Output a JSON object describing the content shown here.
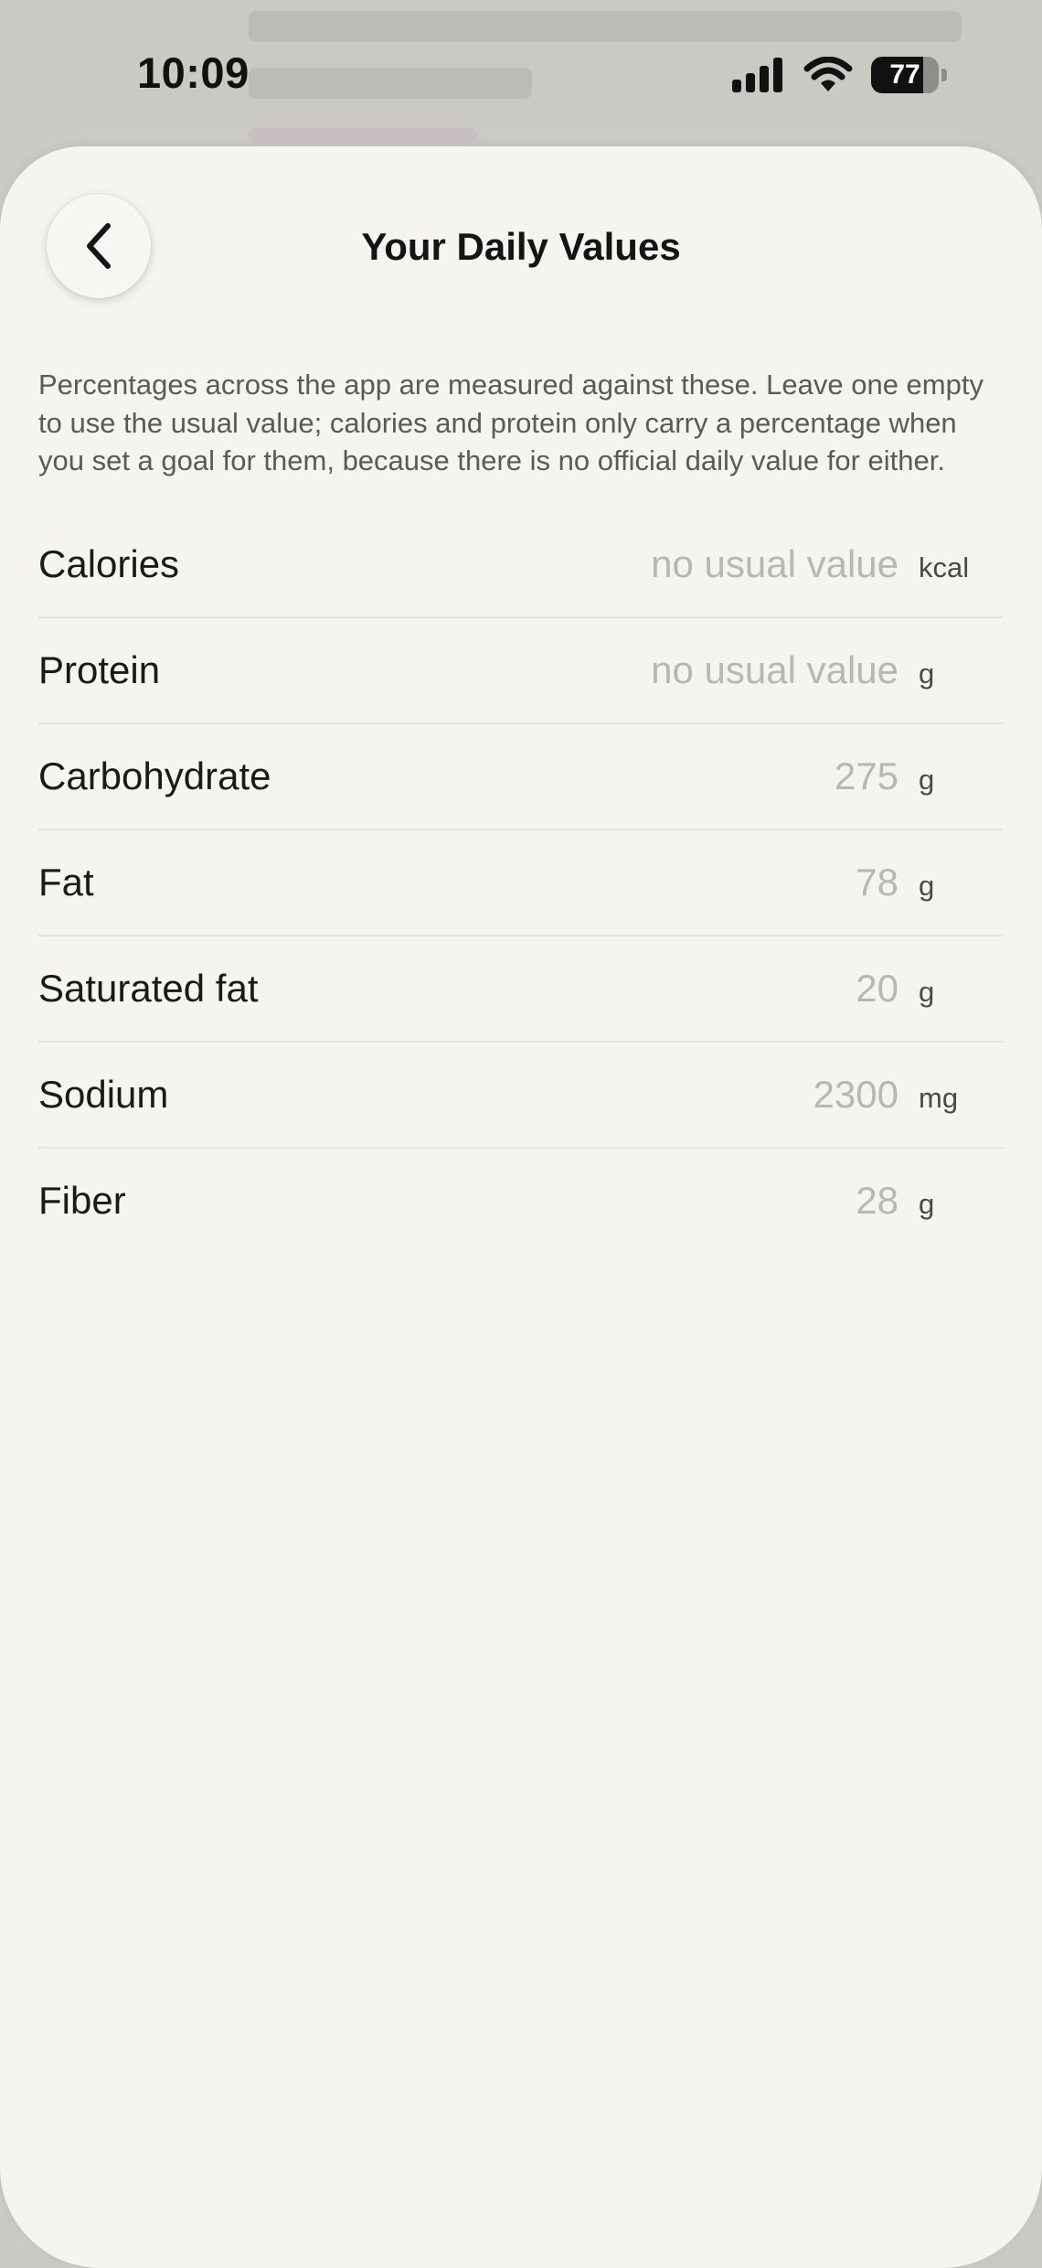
{
  "status_bar": {
    "time": "10:09",
    "battery_level": "77",
    "battery_fraction": 0.77,
    "icons": [
      "cellular-signal-icon",
      "wifi-icon",
      "battery-icon"
    ]
  },
  "sheet": {
    "title": "Your Daily Values",
    "back_icon": "chevron-left-icon",
    "description": "Percentages across the app are measured against these. Leave one empty to use the usual value; calories and protein only carry a percentage when you set a goal for them, because there is no official daily value for either."
  },
  "daily_values": [
    {
      "label": "Calories",
      "value": "",
      "placeholder": "no usual value",
      "unit": "kcal"
    },
    {
      "label": "Protein",
      "value": "",
      "placeholder": "no usual value",
      "unit": "g"
    },
    {
      "label": "Carbohydrate",
      "value": "",
      "placeholder": "275",
      "unit": "g"
    },
    {
      "label": "Fat",
      "value": "",
      "placeholder": "78",
      "unit": "g"
    },
    {
      "label": "Saturated fat",
      "value": "",
      "placeholder": "20",
      "unit": "g"
    },
    {
      "label": "Sodium",
      "value": "",
      "placeholder": "2300",
      "unit": "mg"
    },
    {
      "label": "Fiber",
      "value": "",
      "placeholder": "28",
      "unit": "g"
    }
  ],
  "colors": {
    "sheet_background": "#f5f4ef",
    "backdrop": "#cac9c4",
    "placeholder_text": "#b8b7b2",
    "divider": "#e3e2dd"
  }
}
